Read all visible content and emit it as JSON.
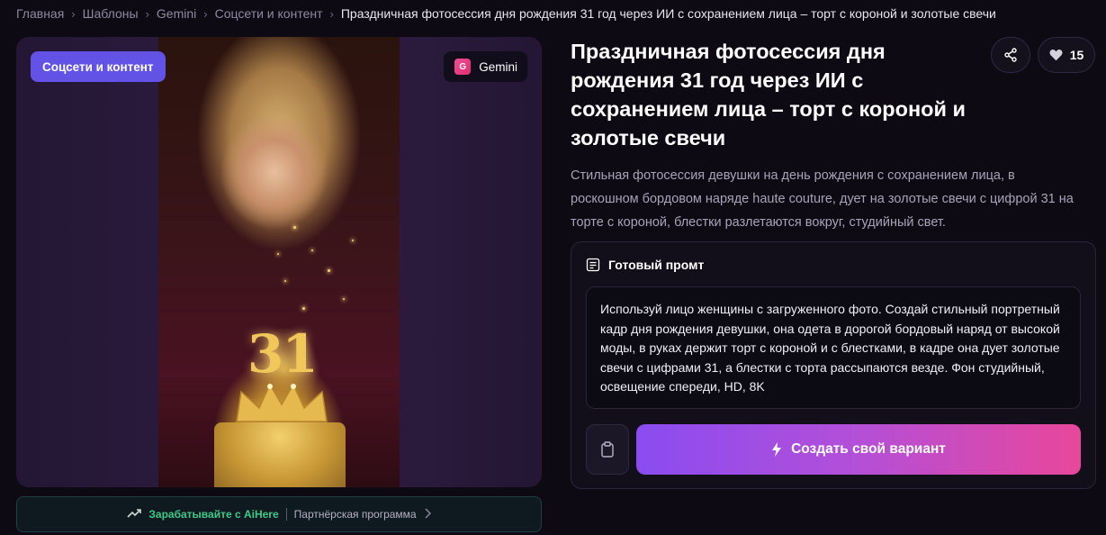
{
  "breadcrumb": {
    "items": [
      "Главная",
      "Шаблоны",
      "Gemini",
      "Соцсети и контент"
    ],
    "current": "Праздничная фотосессия дня рождения 31 год через ИИ с сохранением лица – торт с короной и золотые свечи"
  },
  "image_card": {
    "category_badge": "Соцсети и контент",
    "model_badge": "Gemini",
    "model_icon_letter": "G",
    "candle_number": "31"
  },
  "affiliate": {
    "earn_text": "Зарабатывайте с AiHere",
    "partner_text": "Партнёрская программа",
    "icons": [
      "trend-up-icon",
      "chevron-right-icon"
    ]
  },
  "template": {
    "title": "Праздничная фотосессия дня рождения 31 год через ИИ с сохранением лица – торт с короной и золотые свечи",
    "description": "Стильная фотосессия девушки на день рождения с сохранением лица, в роскошном бордовом наряде haute couture, дует на золотые свечи с цифрой 31 на торте с короной, блестки разлетаются вокруг, студийный свет.",
    "likes": "15"
  },
  "prompt": {
    "header": "Готовый промт",
    "text": "Используй лицо женщины с загруженного фото. Создай стильный портретный кадр дня рождения девушки, она одета в дорогой бордовый наряд от высокой моды, в руках держит торт с короной и с блестками, в кадре она дует золотые свечи с цифрами 31, а блестки с торта рассыпаются везде. Фон студийный, освещение спереди, HD, 8K",
    "create_button": "Создать свой вариант"
  },
  "colors": {
    "accent_purple": "#6252e6",
    "gradient_start": "#8a4cf0",
    "gradient_end": "#e8479a",
    "affiliate_green": "#3ec98a",
    "background": "#0d0a14"
  }
}
